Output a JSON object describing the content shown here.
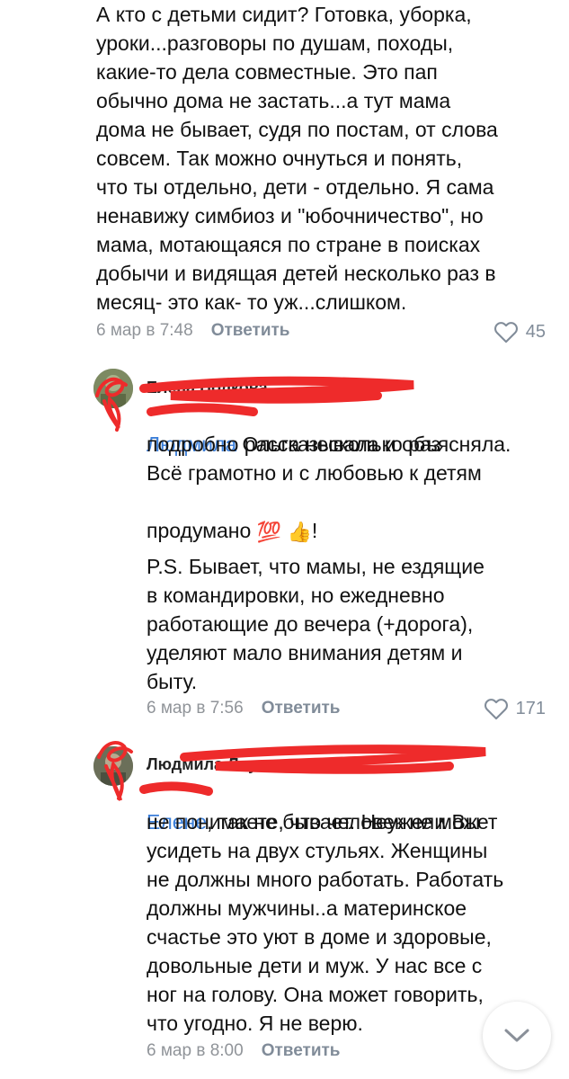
{
  "comment1": {
    "text": "А кто с детьми сидит? Готовка, уборка,\nуроки...разговоры по душам, походы,\nкакие-то дела совместные. Это пап\nобычно дома не застать...а тут мама\nдома не бывает, судя по постам, от слова\nсовсем. Так можно очнуться и понять,\nчто ты отдельно, дети - отдельно. Я сама\nненавижу симбиоз и \"юбочничество\", но\nмама, мотающаяся по стране в поисках\nдобычи и видящая детей несколько раз в\nмесяц- это как- то уж...слишком.",
    "date": "6 мар в 7:48",
    "reply": "Ответить",
    "likes": "45"
  },
  "comment2": {
    "author": "Елена Полкова",
    "mention": "Людмила",
    "text_line1": " Ольга несколько раз",
    "text_rest": "подробно рассказывала и объясняла.\nВсё грамотно и с любовью к детям",
    "text_before_emoji": "продумано ",
    "emoji_100": "💯",
    "emoji_thumb": "👍",
    "text_after_emoji": "!",
    "ps": "P.S. Бывает, что мамы, не ездящие\nв командировки, но ежедневно\nработающие до вечера (+дорога),\nуделяют мало внимания детям и\nбыту.",
    "date": "6 мар в 7:56",
    "reply": "Ответить",
    "likes": "171"
  },
  "comment3": {
    "author": "Людмила Лау",
    "mention": "Елене",
    "text_line1": ", так не бывает. Неужели Вы",
    "text_rest": "не понимаете, что человек не может\nусидеть на двух стульях. Женщины\nне должны много работать. Работать\nдолжны мужчины..а материнское\nсчастье это уют в доме и здоровые,\nдовольные дети и муж. У нас все с\nног на голову. Она может говорить,\nчто угодно. Я не верю.",
    "date": "6 мар в 8:00",
    "reply": "Ответить"
  },
  "icons": {
    "like": "heart-outline-icon",
    "scroll_down": "chevron-down-icon"
  },
  "colors": {
    "link": "#3b7ed8",
    "meta": "#818c99",
    "redaction": "#ee2b2b"
  }
}
